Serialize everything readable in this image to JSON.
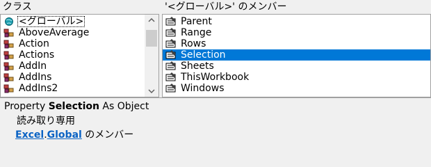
{
  "classes_pane": {
    "header": "クラス",
    "items": [
      {
        "label": "<グローバル>",
        "icon": "globe-icon",
        "selected": true
      },
      {
        "label": "AboveAverage",
        "icon": "class-module-icon"
      },
      {
        "label": "Action",
        "icon": "class-module-icon"
      },
      {
        "label": "Actions",
        "icon": "class-module-icon"
      },
      {
        "label": "AddIn",
        "icon": "class-module-icon"
      },
      {
        "label": "AddIns",
        "icon": "class-module-icon"
      },
      {
        "label": "AddIns2",
        "icon": "class-module-icon"
      }
    ]
  },
  "members_pane": {
    "header": "'<グローバル>' のメンバー",
    "items": [
      {
        "label": "Parent",
        "icon": "property-icon"
      },
      {
        "label": "Range",
        "icon": "property-icon"
      },
      {
        "label": "Rows",
        "icon": "property-icon"
      },
      {
        "label": "Selection",
        "icon": "property-icon",
        "selected": true
      },
      {
        "label": "Sheets",
        "icon": "property-icon"
      },
      {
        "label": "ThisWorkbook",
        "icon": "property-icon"
      },
      {
        "label": "Windows",
        "icon": "property-icon"
      }
    ]
  },
  "details": {
    "kind": "Property",
    "member": "Selection",
    "type_text": "As Object",
    "readonly": "読み取り専用",
    "library_link": "Excel",
    "dot": ".",
    "class_link": "Global",
    "member_of": "のメンバー"
  },
  "colors": {
    "selection": "#0078d7",
    "link": "#0b63c4"
  }
}
